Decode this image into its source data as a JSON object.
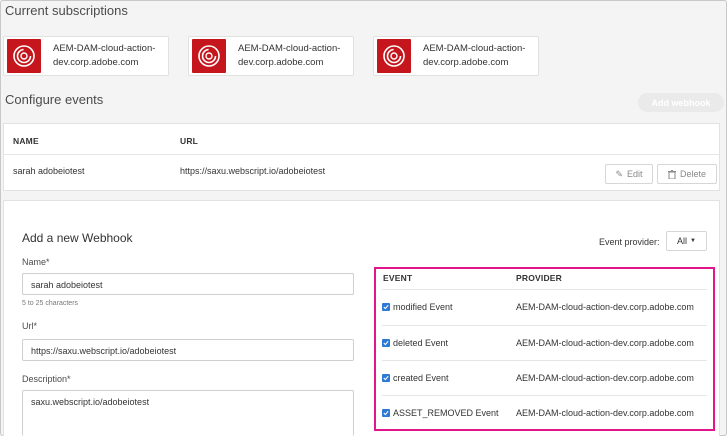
{
  "current_subscriptions": {
    "title": "Current subscriptions",
    "items": [
      {
        "line1": "AEM-DAM-cloud-action-",
        "line2": "dev.corp.adobe.com"
      },
      {
        "line1": "AEM-DAM-cloud-action-",
        "line2": "dev.corp.adobe.com"
      },
      {
        "line1": "AEM-DAM-cloud-action-",
        "line2": "dev.corp.adobe.com"
      }
    ]
  },
  "configure_events": {
    "title": "Configure events",
    "add_webhook_label": "Add webhook",
    "table": {
      "headers": {
        "name": "NAME",
        "url": "URL"
      },
      "rows": [
        {
          "name": "sarah adobeiotest",
          "url": "https://saxu.webscript.io/adobeiotest",
          "edit_label": "Edit",
          "delete_label": "Delete"
        }
      ]
    }
  },
  "new_webhook": {
    "title": "Add a new Webhook",
    "name_label": "Name*",
    "name_value": "sarah adobeiotest",
    "name_hint": "5 to 25 characters",
    "url_label": "Url*",
    "url_value": "https://saxu.webscript.io/adobeiotest",
    "description_label": "Description*",
    "description_value": "saxu.webscript.io/adobeiotest",
    "event_provider_label": "Event provider:",
    "event_provider_value": "All"
  },
  "events_table": {
    "headers": {
      "event": "EVENT",
      "provider": "PROVIDER"
    },
    "rows": [
      {
        "event": "modified Event",
        "provider": "AEM-DAM-cloud-action-dev.corp.adobe.com",
        "checked": true
      },
      {
        "event": "deleted Event",
        "provider": "AEM-DAM-cloud-action-dev.corp.adobe.com",
        "checked": true
      },
      {
        "event": "created Event",
        "provider": "AEM-DAM-cloud-action-dev.corp.adobe.com",
        "checked": true
      },
      {
        "event": "ASSET_REMOVED Event",
        "provider": "AEM-DAM-cloud-action-dev.corp.adobe.com",
        "checked": true
      }
    ]
  },
  "colors": {
    "highlight": "#e0168a",
    "brand_red": "#c4161c",
    "checkbox_blue": "#2d7ad6"
  }
}
